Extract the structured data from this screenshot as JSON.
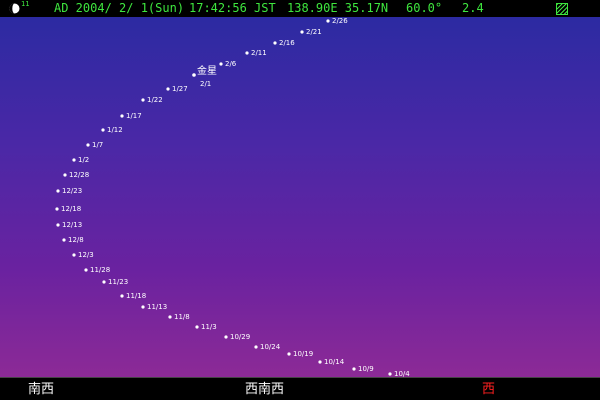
{
  "status": {
    "moon_age": "11",
    "date": "AD 2004/ 2/ 1(Sun)",
    "time": "17:42:56 JST",
    "location": "138.90E 35.17N",
    "fov": "60.0°",
    "magnitude": "2.4"
  },
  "colors": {
    "status_text": "#3ee63e",
    "sky_top": "#2c2aa2",
    "sky_bottom": "#8c2a96",
    "west_label": "#ff2020",
    "star": "#ffffff"
  },
  "planet": {
    "name": "金星",
    "current_label": "2/1"
  },
  "track_labels": [
    "2/26",
    "2/21",
    "2/16",
    "2/11",
    "2/6",
    "1/27",
    "1/22",
    "1/17",
    "1/12",
    "1/7",
    "1/2",
    "12/28",
    "12/23",
    "12/18",
    "12/13",
    "12/8",
    "12/3",
    "11/28",
    "11/23",
    "11/18",
    "11/13",
    "11/8",
    "11/3",
    "10/29",
    "10/24",
    "10/19",
    "10/14",
    "10/9",
    "10/4"
  ],
  "directions": {
    "southwest": "南西",
    "west_southwest": "西南西",
    "west": "西"
  }
}
